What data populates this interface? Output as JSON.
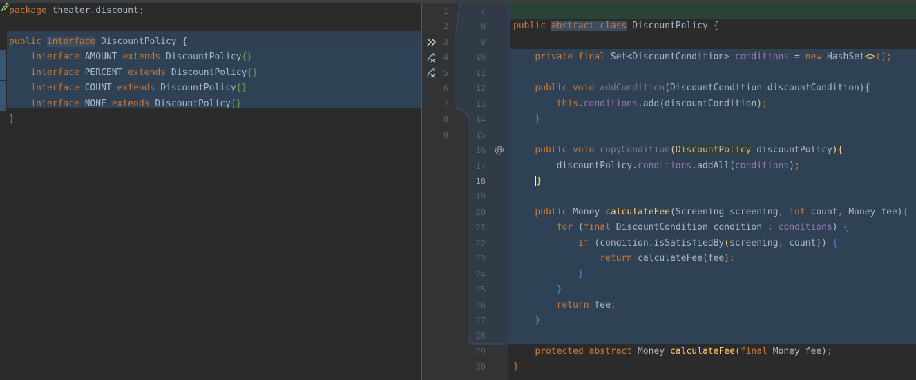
{
  "left_editor": {
    "lines": [
      {
        "num": "1",
        "segments": [
          {
            "t": "package ",
            "c": "kw"
          },
          {
            "t": "theater.discount",
            "c": "cls"
          },
          {
            "t": ";",
            "c": "kw"
          }
        ]
      },
      {
        "num": "2",
        "segments": []
      },
      {
        "num": "3",
        "segments": [
          {
            "t": "public ",
            "c": "kw"
          },
          {
            "t": "interface",
            "c": "kw hlsel"
          },
          {
            "t": " DiscountPolicy {",
            "c": "cls"
          }
        ]
      },
      {
        "num": "4",
        "segments": [
          {
            "t": "    ",
            "c": "cls"
          },
          {
            "t": "interface ",
            "c": "kw"
          },
          {
            "t": "AMOUNT ",
            "c": "cls"
          },
          {
            "t": "extends ",
            "c": "kw"
          },
          {
            "t": "DiscountPolicy",
            "c": "cls"
          },
          {
            "t": "{}",
            "c": "br-green"
          }
        ]
      },
      {
        "num": "5",
        "segments": [
          {
            "t": "    ",
            "c": "cls"
          },
          {
            "t": "interface ",
            "c": "kw"
          },
          {
            "t": "PERCENT ",
            "c": "cls"
          },
          {
            "t": "extends ",
            "c": "kw"
          },
          {
            "t": "DiscountPolicy",
            "c": "cls"
          },
          {
            "t": "{}",
            "c": "br-green"
          }
        ]
      },
      {
        "num": "6",
        "segments": [
          {
            "t": "    ",
            "c": "cls"
          },
          {
            "t": "interface ",
            "c": "kw"
          },
          {
            "t": "COUNT ",
            "c": "cls"
          },
          {
            "t": "extends ",
            "c": "kw"
          },
          {
            "t": "DiscountPolicy",
            "c": "cls"
          },
          {
            "t": "{}",
            "c": "br-green"
          }
        ]
      },
      {
        "num": "7",
        "segments": [
          {
            "t": "    ",
            "c": "cls"
          },
          {
            "t": "interface ",
            "c": "kw"
          },
          {
            "t": "NONE ",
            "c": "cls"
          },
          {
            "t": "extends ",
            "c": "kw"
          },
          {
            "t": "DiscountPolicy",
            "c": "cls"
          },
          {
            "t": "{}",
            "c": "br-green"
          }
        ]
      },
      {
        "num": "8",
        "segments": [
          {
            "t": "}",
            "c": "kw"
          }
        ]
      },
      {
        "num": "9",
        "segments": []
      }
    ]
  },
  "right_editor": {
    "lines": [
      {
        "num": "7",
        "segments": []
      },
      {
        "num": "8",
        "segments": [
          {
            "t": "public ",
            "c": "kw"
          },
          {
            "t": "abstract class",
            "c": "kw hlsel"
          },
          {
            "t": " DiscountPolicy {",
            "c": "cls"
          }
        ]
      },
      {
        "num": "9",
        "segments": []
      },
      {
        "num": "10",
        "segments": [
          {
            "t": "    ",
            "c": "cls"
          },
          {
            "t": "private final ",
            "c": "kw"
          },
          {
            "t": "Set<DiscountCondition> ",
            "c": "cls"
          },
          {
            "t": "conditions",
            "c": "fld"
          },
          {
            "t": " = ",
            "c": "cls"
          },
          {
            "t": "new ",
            "c": "kw"
          },
          {
            "t": "HashSet",
            "c": "cls"
          },
          {
            "t": "<>",
            "c": "meth"
          },
          {
            "t": "();",
            "c": "kw"
          }
        ]
      },
      {
        "num": "11",
        "segments": []
      },
      {
        "num": "12",
        "segments": [
          {
            "t": "    ",
            "c": "cls"
          },
          {
            "t": "public void ",
            "c": "kw"
          },
          {
            "t": "addCondition",
            "c": "muted"
          },
          {
            "t": "(DiscountCondition discountCondition)",
            "c": "cls"
          },
          {
            "t": "{",
            "c": "cls hlsel"
          }
        ]
      },
      {
        "num": "13",
        "segments": [
          {
            "t": "        ",
            "c": "cls"
          },
          {
            "t": "this",
            "c": "kw"
          },
          {
            "t": ".",
            "c": "cls"
          },
          {
            "t": "conditions",
            "c": "fld"
          },
          {
            "t": ".add(discountCondition)",
            "c": "cls"
          },
          {
            "t": ";",
            "c": "kw"
          }
        ]
      },
      {
        "num": "14",
        "segments": [
          {
            "t": "    ",
            "c": "cls"
          },
          {
            "t": "}",
            "c": "br-green"
          }
        ]
      },
      {
        "num": "15",
        "segments": []
      },
      {
        "num": "16",
        "segments": [
          {
            "t": "    ",
            "c": "cls"
          },
          {
            "t": "public void ",
            "c": "kw"
          },
          {
            "t": "copyCondition",
            "c": "muted"
          },
          {
            "t": "(",
            "c": "meth"
          },
          {
            "t": "DiscountPolicy",
            "c": "cls hl"
          },
          {
            "t": " discountPolicy",
            "c": "cls"
          },
          {
            "t": "){",
            "c": "meth"
          }
        ]
      },
      {
        "num": "17",
        "segments": [
          {
            "t": "        discountPolicy.",
            "c": "cls"
          },
          {
            "t": "conditions",
            "c": "fld"
          },
          {
            "t": ".addAll(",
            "c": "cls"
          },
          {
            "t": "conditions",
            "c": "fld"
          },
          {
            "t": ")",
            "c": "cls"
          },
          {
            "t": ";",
            "c": "kw"
          }
        ]
      },
      {
        "num": "18",
        "segments": [
          {
            "t": "    ",
            "c": "cls"
          },
          {
            "t": "}",
            "c": "ybrace caret"
          }
        ]
      },
      {
        "num": "19",
        "segments": []
      },
      {
        "num": "20",
        "segments": [
          {
            "t": "    ",
            "c": "cls"
          },
          {
            "t": "public ",
            "c": "kw"
          },
          {
            "t": "Money ",
            "c": "cls"
          },
          {
            "t": "calculateFee",
            "c": "meth"
          },
          {
            "t": "(Screening screening",
            "c": "cls"
          },
          {
            "t": ", ",
            "c": "kw"
          },
          {
            "t": "int ",
            "c": "kw"
          },
          {
            "t": "count",
            "c": "cls"
          },
          {
            "t": ", ",
            "c": "kw"
          },
          {
            "t": "Money fee)",
            "c": "cls"
          },
          {
            "t": "{",
            "c": "br-green"
          }
        ]
      },
      {
        "num": "21",
        "segments": [
          {
            "t": "        ",
            "c": "cls"
          },
          {
            "t": "for ",
            "c": "kw"
          },
          {
            "t": "(",
            "c": "cls"
          },
          {
            "t": "final ",
            "c": "kw"
          },
          {
            "t": "DiscountCondition condition : ",
            "c": "cls"
          },
          {
            "t": "conditions",
            "c": "fld"
          },
          {
            "t": ") ",
            "c": "cls"
          },
          {
            "t": "{",
            "c": "br-blue"
          }
        ]
      },
      {
        "num": "22",
        "segments": [
          {
            "t": "            ",
            "c": "cls"
          },
          {
            "t": "if ",
            "c": "kw"
          },
          {
            "t": "(condition.isSatisfiedBy",
            "c": "cls"
          },
          {
            "t": "(",
            "c": "meth"
          },
          {
            "t": "screening",
            "c": "cls"
          },
          {
            "t": ", ",
            "c": "kw"
          },
          {
            "t": "count",
            "c": "cls"
          },
          {
            "t": ")",
            "c": "meth"
          },
          {
            "t": ") ",
            "c": "cls"
          },
          {
            "t": "{",
            "c": "br-blue"
          }
        ]
      },
      {
        "num": "23",
        "segments": [
          {
            "t": "                ",
            "c": "cls"
          },
          {
            "t": "return ",
            "c": "kw"
          },
          {
            "t": "calculateFee",
            "c": "cls"
          },
          {
            "t": "(",
            "c": "meth"
          },
          {
            "t": "fee",
            "c": "cls"
          },
          {
            "t": ")",
            "c": "meth"
          },
          {
            "t": ";",
            "c": "kw"
          }
        ]
      },
      {
        "num": "24",
        "segments": [
          {
            "t": "            ",
            "c": "cls"
          },
          {
            "t": "}",
            "c": "br-blue"
          }
        ]
      },
      {
        "num": "25",
        "segments": [
          {
            "t": "        ",
            "c": "cls"
          },
          {
            "t": "}",
            "c": "br-blue"
          }
        ]
      },
      {
        "num": "26",
        "segments": [
          {
            "t": "        ",
            "c": "cls"
          },
          {
            "t": "return ",
            "c": "kw"
          },
          {
            "t": "fee",
            "c": "cls"
          },
          {
            "t": ";",
            "c": "kw"
          }
        ]
      },
      {
        "num": "27",
        "segments": [
          {
            "t": "    ",
            "c": "cls"
          },
          {
            "t": "}",
            "c": "br-green"
          }
        ]
      },
      {
        "num": "28",
        "segments": []
      },
      {
        "num": "29",
        "segments": [
          {
            "t": "    ",
            "c": "cls"
          },
          {
            "t": "protected abstract ",
            "c": "kw"
          },
          {
            "t": "Money ",
            "c": "cls"
          },
          {
            "t": "calculateFee",
            "c": "meth"
          },
          {
            "t": "(",
            "c": "cls"
          },
          {
            "t": "final ",
            "c": "kw"
          },
          {
            "t": "Money fee)",
            "c": "cls"
          },
          {
            "t": ";",
            "c": "kw"
          }
        ]
      },
      {
        "num": "30",
        "segments": [
          {
            "t": "}",
            "c": "kw"
          }
        ]
      }
    ]
  },
  "gutter_icons": {
    "line3": "merge-arrows-icon",
    "line4": "apply-change-icon",
    "line5": "apply-change-icon",
    "line16": "override-at-icon"
  },
  "current_line": "18",
  "colors": {
    "background": "#2b2b2b",
    "gutter": "#313335",
    "selection": "#2f4255",
    "added": "#294436",
    "keyword": "#cc7832",
    "field": "#9876aa",
    "method": "#ffc66d"
  }
}
